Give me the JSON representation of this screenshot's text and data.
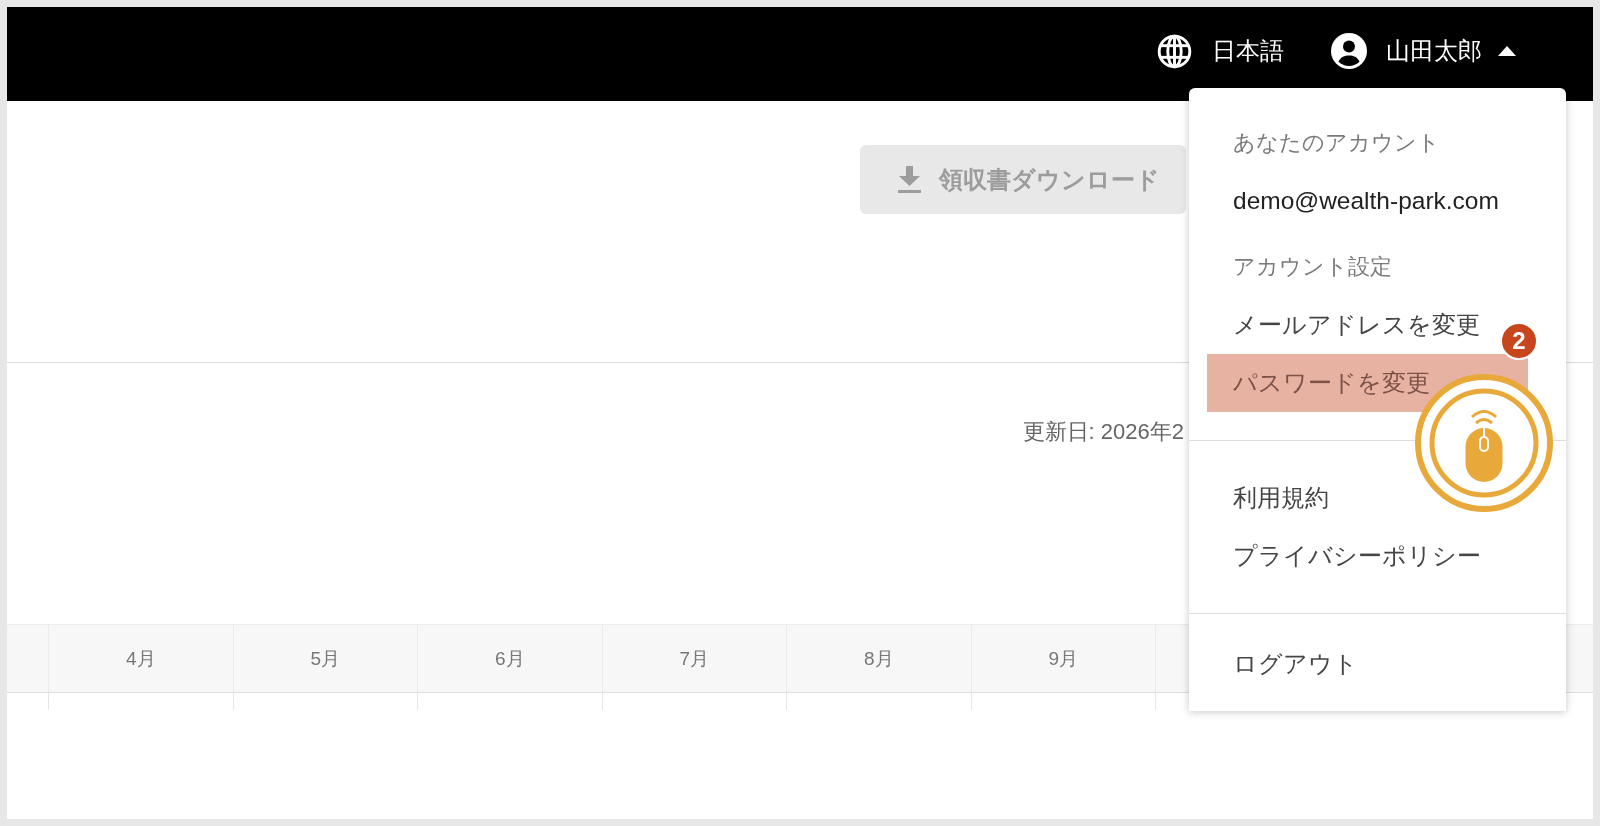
{
  "header": {
    "language_button": {
      "label": "日本語"
    },
    "user_menu": {
      "name": "山田太郎",
      "expanded": true
    }
  },
  "download_button": {
    "label": "領収書ダウンロード",
    "disabled": true
  },
  "updated_label": "更新日: 2026年2",
  "table": {
    "columns": [
      "4月",
      "5月",
      "6月",
      "7月",
      "8月",
      "9月"
    ]
  },
  "account_menu": {
    "groups": [
      {
        "items": [
          {
            "kind": "heading",
            "label": "あなたのアカウント"
          },
          {
            "kind": "email",
            "label": "demo@wealth-park.com"
          },
          {
            "kind": "heading",
            "label": "アカウント設定"
          },
          {
            "kind": "link",
            "label": "メールアドレスを変更",
            "highlighted": false
          },
          {
            "kind": "link",
            "label": "パスワードを変更",
            "highlighted": true
          }
        ]
      },
      {
        "items": [
          {
            "kind": "link",
            "label": "利用規約",
            "highlighted": false
          },
          {
            "kind": "link",
            "label": "プライバシーポリシー",
            "highlighted": false
          }
        ]
      },
      {
        "items": [
          {
            "kind": "link",
            "label": "ログアウト",
            "highlighted": false
          }
        ]
      }
    ]
  },
  "annotation": {
    "step": "2"
  }
}
